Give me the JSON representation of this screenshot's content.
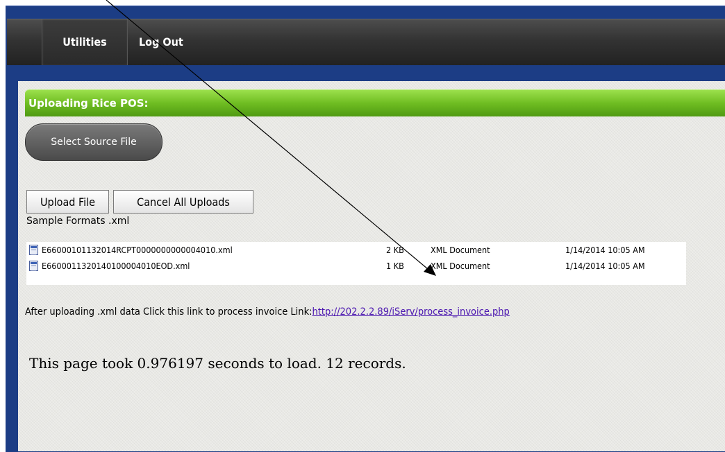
{
  "nav": {
    "tabs": [
      {
        "label": "Utilities"
      },
      {
        "label": "Log Out"
      }
    ]
  },
  "panel": {
    "title": "Uploading Rice POS:",
    "select_source_label": "Select Source File",
    "upload_label": "Upload File",
    "cancel_label": "Cancel All Uploads",
    "sample_formats": "Sample Formats .xml"
  },
  "files": [
    {
      "name": "E66000101132014RCPT0000000000004010.xml",
      "size": "2 KB",
      "type": "XML Document",
      "date": "1/14/2014 10:05 AM"
    },
    {
      "name": "E6600011320140100004010EOD.xml",
      "size": "1 KB",
      "type": "XML Document",
      "date": "1/14/2014 10:05 AM"
    }
  ],
  "process": {
    "text": "After uploading .xml data Click this link to process invoice Link:",
    "link": "http://202.2.2.89/iServ/process_invoice.php"
  },
  "footer": {
    "load_text": "This page took 0.976197 seconds to load. 12 records."
  },
  "colors": {
    "frame": "#1c3d85",
    "green_header": "#6fbd22",
    "link": "#4b16b0"
  }
}
